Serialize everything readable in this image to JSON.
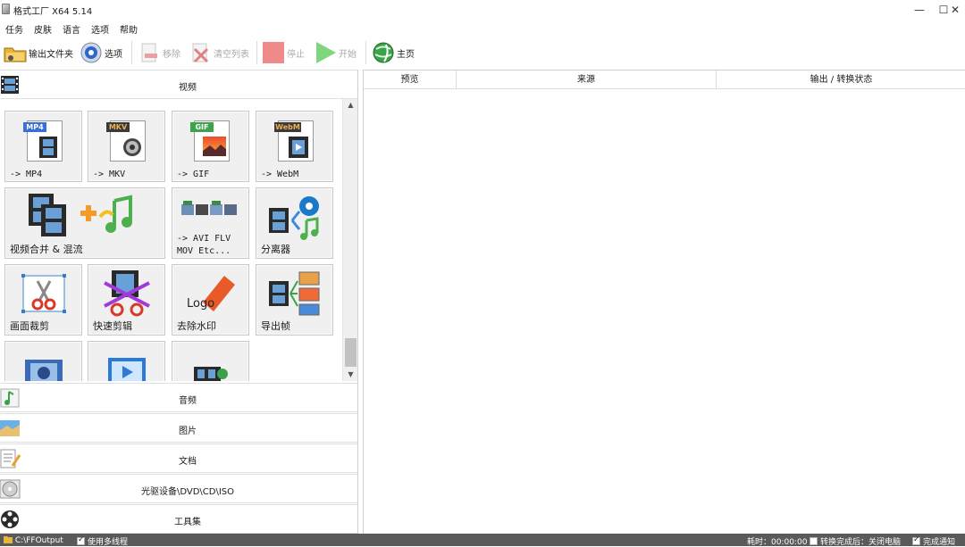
{
  "window": {
    "title": "格式工厂 X64 5.14",
    "minimize": "—",
    "maximize": "☐",
    "close": "✕"
  },
  "menu": [
    "任务",
    "皮肤",
    "语言",
    "选项",
    "帮助"
  ],
  "toolbar": {
    "output_folder": "输出文件夹",
    "options": "选项",
    "remove": "移除",
    "clear_list": "清空列表",
    "stop": "停止",
    "start": "开始",
    "home": "主页"
  },
  "categories": {
    "video": "视频",
    "audio": "音频",
    "picture": "图片",
    "document": "文档",
    "optical": "光驱设备\\DVD\\CD\\ISO",
    "tools": "工具集"
  },
  "tiles": {
    "mp4": {
      "label": "-> MP4",
      "badge": "MP4"
    },
    "mkv": {
      "label": "-> MKV",
      "badge": "MKV"
    },
    "gif": {
      "label": "-> GIF",
      "badge": "GIF"
    },
    "webm": {
      "label": "-> WebM",
      "badge": "WebM"
    },
    "merge": {
      "label": "视频合并 & 混流"
    },
    "avi": {
      "label_line1": "-> AVI FLV",
      "label_line2": "MOV Etc..."
    },
    "splitter": {
      "label": "分离器"
    },
    "crop": {
      "label": "画面裁剪"
    },
    "quick_clip": {
      "label": "快速剪辑"
    },
    "watermark": {
      "label": "去除水印",
      "logo_text": "Logo"
    },
    "export_frames": {
      "label": "导出帧"
    }
  },
  "columns": [
    "预览",
    "来源",
    "输出 / 转换状态"
  ],
  "status": {
    "path": "C:\\FFOutput",
    "multithread": "使用多线程",
    "elapsed": "耗时：00:00:00",
    "shutdown": "转换完成后：关闭电脑",
    "notify": "完成通知"
  },
  "colors": {
    "mp4_badge": "#3b6fd6",
    "mkv_badge": "#3a3a3a",
    "gif_badge": "#3fa34d",
    "webm_badge": "#3a3a3a",
    "statusbar": "#5a5a5a",
    "stop_red": "#f08a8a",
    "start_green": "#7fd67f"
  }
}
